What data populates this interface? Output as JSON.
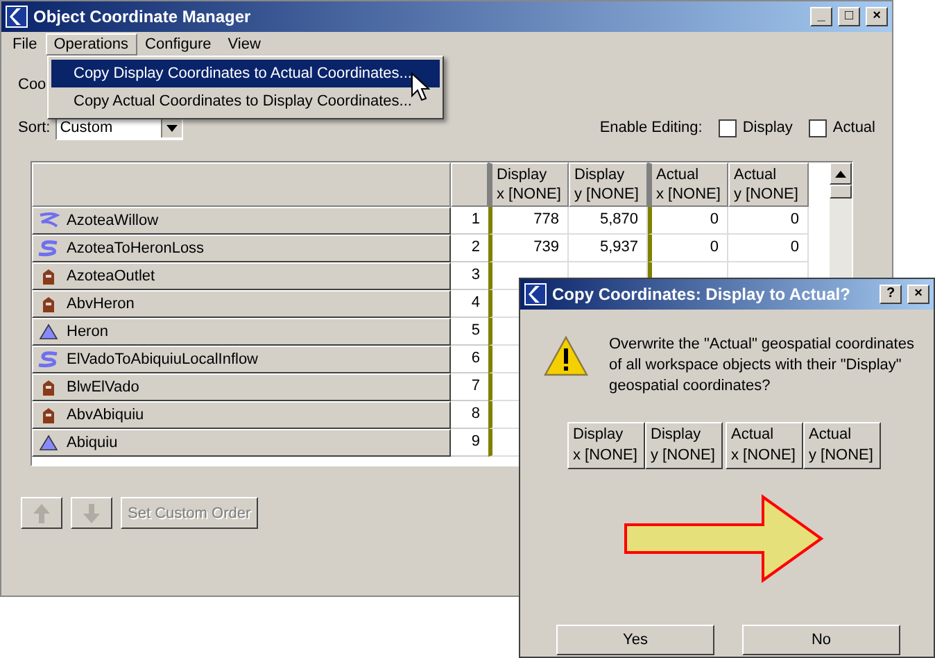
{
  "window": {
    "title": "Object Coordinate Manager",
    "controls": [
      "_",
      "□",
      "×"
    ]
  },
  "menu_bar": [
    {
      "label": "File",
      "selected": false
    },
    {
      "label": "Operations",
      "selected": true
    },
    {
      "label": "Configure",
      "selected": false
    },
    {
      "label": "View",
      "selected": false
    }
  ],
  "menu": {
    "items": [
      {
        "label": "Copy Display Coordinates to Actual Coordinates...",
        "selected": true
      },
      {
        "label": "Copy Actual Coordinates to Display Coordinates...",
        "selected": false
      }
    ]
  },
  "partial_label": "Coo",
  "sort": {
    "label": "Sort:",
    "value": "Custom"
  },
  "enable_editing": {
    "label": "Enable Editing:",
    "options": [
      {
        "label": "Display",
        "checked": false
      },
      {
        "label": "Actual",
        "checked": false
      }
    ]
  },
  "table": {
    "columns": [
      "Display\nx [NONE]",
      "Display\ny [NONE]",
      "Actual\nx [NONE]",
      "Actual\ny [NONE]"
    ],
    "rows": [
      {
        "name": "AzoteaWillow",
        "kind": "reach",
        "index": "1",
        "values": [
          "778",
          "5,870",
          "0",
          "0"
        ]
      },
      {
        "name": "AzoteaToHeronLoss",
        "kind": "inflow",
        "index": "2",
        "values": [
          "739",
          "5,937",
          "0",
          "0"
        ]
      },
      {
        "name": "AzoteaOutlet",
        "kind": "gage",
        "index": "3"
      },
      {
        "name": "AbvHeron",
        "kind": "gage",
        "index": "4"
      },
      {
        "name": "Heron",
        "kind": "reservoir",
        "index": "5"
      },
      {
        "name": "ElVadoToAbiquiuLocalInflow",
        "kind": "inflow",
        "index": "6"
      },
      {
        "name": "BlwElVado",
        "kind": "gage",
        "index": "7"
      },
      {
        "name": "AbvAbiquiu",
        "kind": "gage",
        "index": "8"
      },
      {
        "name": "Abiquiu",
        "kind": "reservoir",
        "index": "9"
      }
    ]
  },
  "buttons": [
    {
      "kind": "up",
      "disabled": true
    },
    {
      "kind": "down",
      "disabled": true
    },
    {
      "kind": "text",
      "label": "Set Custom Order",
      "disabled": true
    }
  ],
  "dialog": {
    "title": "Copy Coordinates: Display to Actual?",
    "controls": [
      "?",
      "×"
    ],
    "message": "Overwrite the \"Actual\" geospatial coordinates of all workspace objects with their \"Display\" geospatial coordinates?",
    "columns": [
      "Display\nx [NONE]",
      "Display\ny [NONE]",
      "Actual\nx [NONE]",
      "Actual\ny [NONE]"
    ],
    "buttons": [
      "Yes",
      "No"
    ]
  }
}
